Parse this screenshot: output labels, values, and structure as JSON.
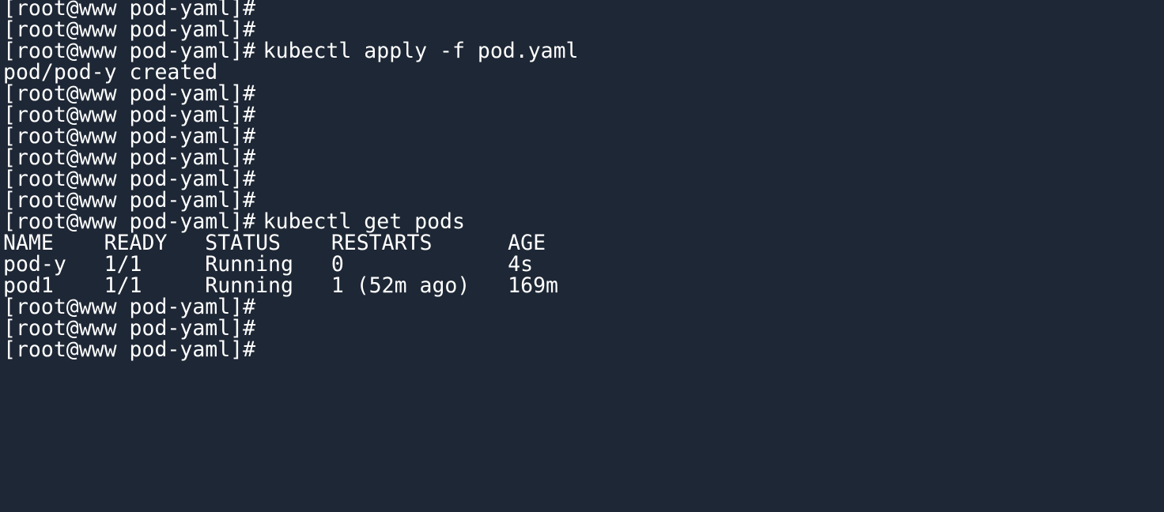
{
  "terminal": {
    "prompt": "[root@www pod-yaml]#",
    "lines": [
      {
        "type": "prompt",
        "command": ""
      },
      {
        "type": "prompt",
        "command": ""
      },
      {
        "type": "prompt",
        "command": "kubectl apply -f pod.yaml"
      },
      {
        "type": "output",
        "text": "pod/pod-y created"
      },
      {
        "type": "prompt",
        "command": ""
      },
      {
        "type": "prompt",
        "command": ""
      },
      {
        "type": "prompt",
        "command": ""
      },
      {
        "type": "prompt",
        "command": ""
      },
      {
        "type": "prompt",
        "command": ""
      },
      {
        "type": "prompt",
        "command": ""
      },
      {
        "type": "prompt",
        "command": "kubectl get pods"
      },
      {
        "type": "output",
        "text": "NAME    READY   STATUS    RESTARTS      AGE"
      },
      {
        "type": "output",
        "text": "pod-y   1/1     Running   0             4s"
      },
      {
        "type": "output",
        "text": "pod1    1/1     Running   1 (52m ago)   169m"
      },
      {
        "type": "prompt",
        "command": ""
      },
      {
        "type": "prompt",
        "command": ""
      },
      {
        "type": "prompt",
        "command": ""
      }
    ]
  },
  "colors": {
    "background": "#1e2735",
    "foreground": "#ffffff"
  }
}
